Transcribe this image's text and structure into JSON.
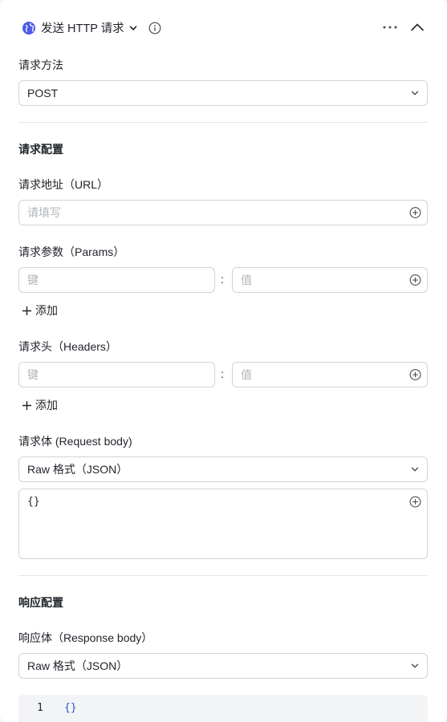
{
  "header": {
    "title": "发送 HTTP 请求",
    "icons": [
      "globe-icon",
      "chevron-down-icon",
      "info-icon",
      "more-icon",
      "collapse-icon"
    ]
  },
  "method": {
    "label": "请求方法",
    "value": "POST"
  },
  "request_config": {
    "section_title": "请求配置",
    "url": {
      "label": "请求地址（URL）",
      "placeholder": "请填写"
    },
    "params": {
      "label": "请求参数（Params）",
      "key_placeholder": "键",
      "value_placeholder": "值",
      "separator": ":",
      "add_label": "添加"
    },
    "headers": {
      "label": "请求头（Headers）",
      "key_placeholder": "键",
      "value_placeholder": "值",
      "separator": ":",
      "add_label": "添加"
    },
    "body": {
      "label": "请求体 (Request body)",
      "format": "Raw 格式（JSON）",
      "content": "{}"
    }
  },
  "response_config": {
    "section_title": "响应配置",
    "body": {
      "label": "响应体（Response body）",
      "format": "Raw 格式（JSON）",
      "line_number": "1",
      "content": "{}"
    }
  },
  "colors": {
    "accent": "#4e5ce6",
    "code_blue": "#2a54c8",
    "border": "#d0d3d6",
    "placeholder": "#b1b4b9"
  }
}
